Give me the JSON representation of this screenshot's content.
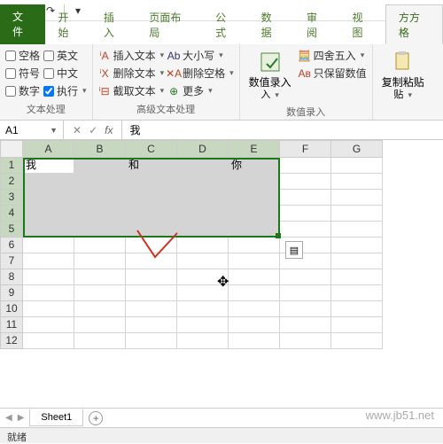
{
  "qat": {
    "save": "save",
    "undo": "undo",
    "redo": "redo"
  },
  "tabs": {
    "file": "文件",
    "home": "开始",
    "insert": "插入",
    "layout": "页面布局",
    "formula": "公式",
    "data": "数据",
    "review": "审阅",
    "view": "视图",
    "addon": "方方格"
  },
  "ribbon": {
    "g1": {
      "label": "文本处理",
      "chks": {
        "space": "空格",
        "en": "英文",
        "symbol": "符号",
        "cn": "中文",
        "number": "数字",
        "exec": "执行"
      }
    },
    "g2": {
      "label": "高级文本处理",
      "insert": "插入文本",
      "delete": "删除文本",
      "cut": "截取文本",
      "case": "大小写",
      "delspace": "删除空格",
      "more": "更多"
    },
    "g3": {
      "label": "数值录入",
      "big": "数值录入",
      "round": "四舍五入",
      "keep": "只保留数值"
    },
    "g4": {
      "big": "复制粘贴"
    }
  },
  "namebox": {
    "cell": "A1",
    "value": "我"
  },
  "cols": [
    "A",
    "B",
    "C",
    "D",
    "E",
    "F",
    "G"
  ],
  "rows": [
    "1",
    "2",
    "3",
    "4",
    "5",
    "6",
    "7",
    "8",
    "9",
    "10",
    "11",
    "12"
  ],
  "cells": {
    "A1": "我",
    "C1": "和",
    "E1": "你"
  },
  "sheet": {
    "name": "Sheet1",
    "status": "就绪"
  },
  "watermark": "www.jb51.net"
}
